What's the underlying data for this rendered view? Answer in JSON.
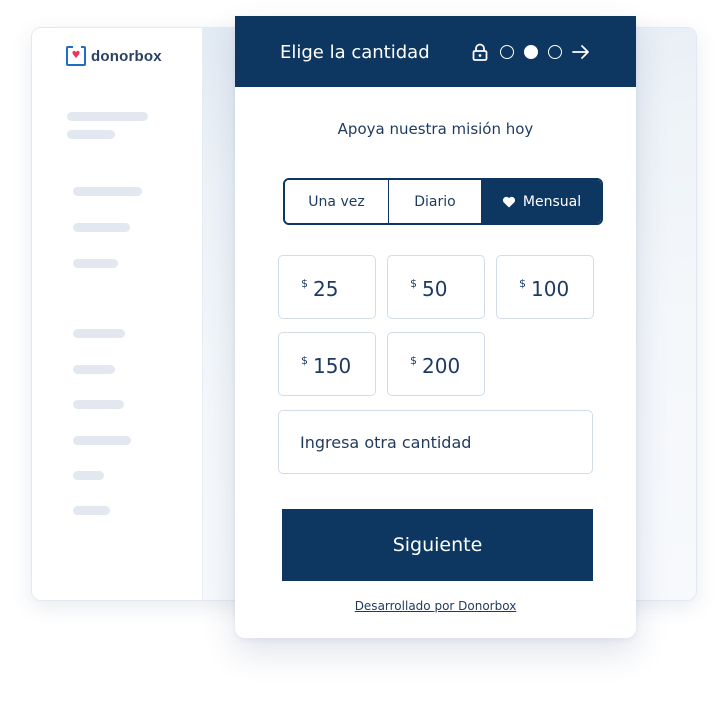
{
  "brand": {
    "name": "donorbox",
    "icon": "donorbox-logo-icon",
    "accent": "#1e6fc4",
    "heart_color": "#e8385a"
  },
  "widget": {
    "title": "Elige la cantidad",
    "header_color": "#0d3760",
    "steps": {
      "total": 3,
      "current": 2
    },
    "subtitle": "Apoya nuestra misión hoy",
    "frequencies": [
      {
        "label": "Una vez",
        "active": false
      },
      {
        "label": "Diario",
        "active": false
      },
      {
        "label": "Mensual",
        "active": true,
        "icon": "heart-icon"
      }
    ],
    "currency": "$",
    "amounts": [
      "25",
      "50",
      "100",
      "150",
      "200"
    ],
    "other_placeholder": "Ingresa otra cantidad",
    "next_label": "Siguiente",
    "powered_by": "Desarrollado por Donorbox"
  }
}
